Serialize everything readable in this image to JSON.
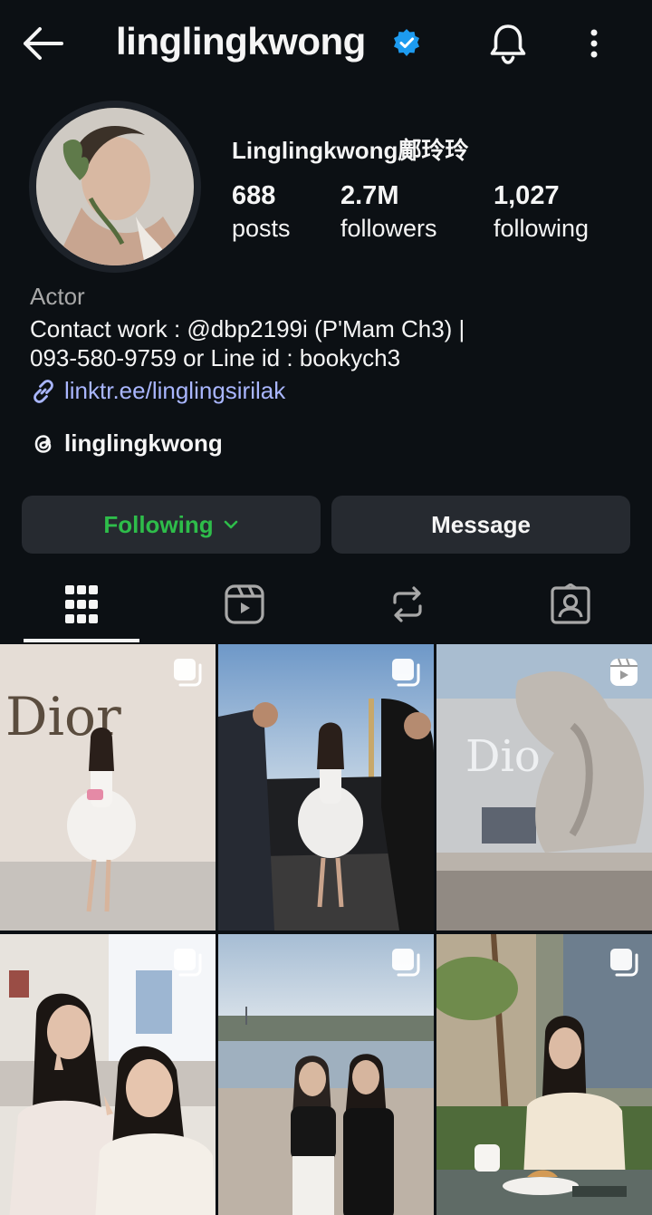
{
  "header": {
    "username": "linglingkwong",
    "icons": [
      "back-arrow-icon",
      "verified-badge-icon",
      "bell-icon",
      "more-vertical-icon"
    ],
    "verified_color": "#1d9bf0"
  },
  "profile": {
    "display_name": "Linglingkwong鄺玲玲",
    "stats": [
      {
        "value": "688",
        "label": "posts"
      },
      {
        "value": "2.7M",
        "label": "followers"
      },
      {
        "value": "1,027",
        "label": "following"
      }
    ],
    "category": "Actor",
    "bio_line1": "Contact work : @dbp2199i (P'Mam Ch3) |",
    "bio_line2": "093-580-9759 or Line id : bookych3",
    "link": "linktr.ee/linglingsirilak",
    "threads_handle": "linglingkwong"
  },
  "actions": {
    "following_label": "Following",
    "message_label": "Message",
    "following_color": "#2ebd4a"
  },
  "tabs": [
    {
      "icon": "grid-icon",
      "active": true
    },
    {
      "icon": "reels-icon",
      "active": false
    },
    {
      "icon": "reposts-icon",
      "active": false
    },
    {
      "icon": "tagged-icon",
      "active": false
    }
  ],
  "posts": [
    {
      "type": "carousel"
    },
    {
      "type": "carousel"
    },
    {
      "type": "reel"
    },
    {
      "type": "carousel"
    },
    {
      "type": "carousel"
    },
    {
      "type": "carousel"
    }
  ],
  "colors": {
    "background": "#0c1014",
    "button_bg": "#262a30",
    "link": "#a9b6ff",
    "muted": "#a8a8a8"
  }
}
